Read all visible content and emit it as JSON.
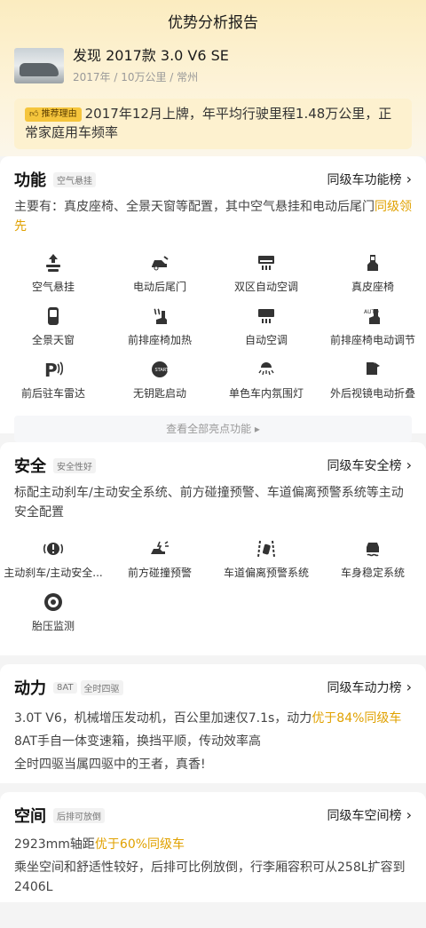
{
  "page": {
    "title": "优势分析报告"
  },
  "car": {
    "name": "发现 2017款 3.0 V6 SE",
    "meta": "2017年 / 10万公里 / 常州"
  },
  "reason": {
    "tag": "推荐理由",
    "text": "2017年12月上牌，年平均行驶里程1.48万公里，正常家庭用车频率"
  },
  "function": {
    "title": "功能",
    "tag": "空气悬挂",
    "link": "同级车功能榜",
    "summary_prefix": "主要有：真皮座椅、全景天窗等配置，其中空气悬挂和电动后尾门",
    "summary_highlight": "同级领先",
    "items": [
      {
        "label": "空气悬挂",
        "icon": "air-suspension-icon"
      },
      {
        "label": "电动后尾门",
        "icon": "power-tailgate-icon"
      },
      {
        "label": "双区自动空调",
        "icon": "dual-zone-ac-icon"
      },
      {
        "label": "真皮座椅",
        "icon": "leather-seat-icon"
      },
      {
        "label": "全景天窗",
        "icon": "panoramic-sunroof-icon"
      },
      {
        "label": "前排座椅加热",
        "icon": "seat-heating-icon"
      },
      {
        "label": "自动空调",
        "icon": "auto-ac-icon"
      },
      {
        "label": "前排座椅电动调节",
        "icon": "power-seat-icon"
      },
      {
        "label": "前后驻车雷达",
        "icon": "parking-radar-icon"
      },
      {
        "label": "无钥匙启动",
        "icon": "keyless-start-icon"
      },
      {
        "label": "单色车内氛围灯",
        "icon": "ambient-light-icon"
      },
      {
        "label": "外后视镜电动折叠",
        "icon": "mirror-fold-icon"
      }
    ],
    "more_label": "查看全部亮点功能"
  },
  "safety": {
    "title": "安全",
    "tag": "安全性好",
    "link": "同级车安全榜",
    "summary": "标配主动刹车/主动安全系统、前方碰撞预警、车道偏离预警系统等主动安全配置",
    "items": [
      {
        "label": "主动刹车/主动安全...",
        "icon": "active-brake-icon"
      },
      {
        "label": "前方碰撞预警",
        "icon": "collision-warning-icon"
      },
      {
        "label": "车道偏离预警系统",
        "icon": "lane-departure-icon"
      },
      {
        "label": "车身稳定系统",
        "icon": "stability-control-icon"
      },
      {
        "label": "胎压监测",
        "icon": "tire-pressure-icon"
      }
    ]
  },
  "power": {
    "title": "动力",
    "tags": [
      "8AT",
      "全时四驱"
    ],
    "link": "同级车动力榜",
    "line1_prefix": "3.0T V6，机械增压发动机，百公里加速仅7.1s，动力",
    "line1_highlight": "优于84%同级车",
    "line2": "8AT手自一体变速箱，换挡平顺，传动效率高",
    "line3": "全时四驱当属四驱中的王者，真香!"
  },
  "space": {
    "title": "空间",
    "tag": "后排可放倒",
    "link": "同级车空间榜",
    "line1_prefix": "2923mm轴距",
    "line1_highlight": "优于60%同级车",
    "line2": "乘坐空间和舒适性较好，后排可比例放倒，行李厢容积可从258L扩容到2406L"
  },
  "colors": {
    "accent": "#e0a100",
    "tag_bg": "#f5c53c",
    "header_bg": "#fbecc0"
  }
}
